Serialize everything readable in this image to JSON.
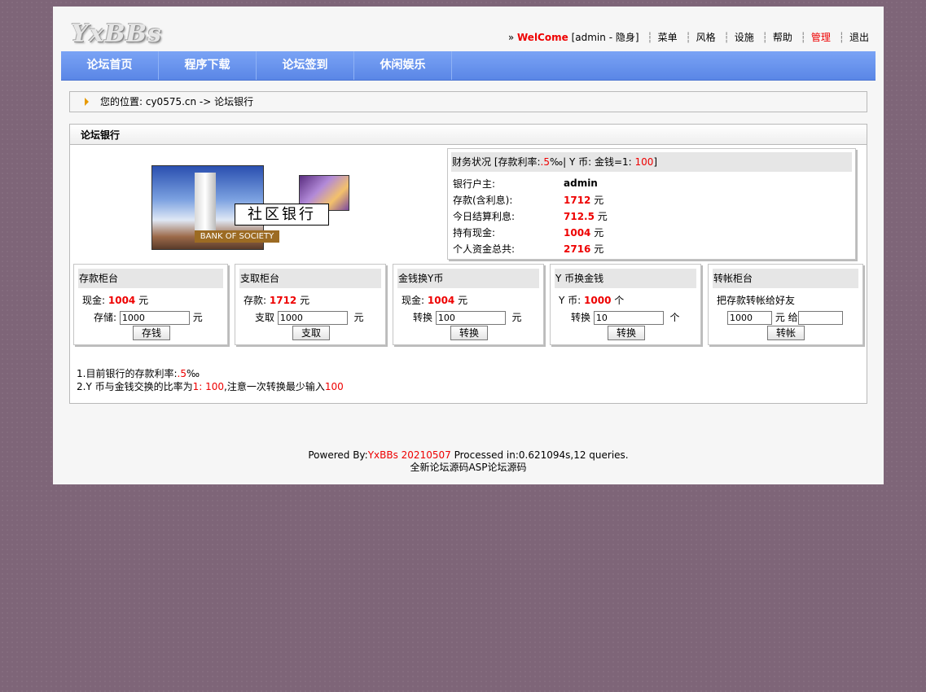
{
  "logo": "YxBBs",
  "topmenu": {
    "prefix": "»",
    "welcome": "WelCome",
    "user": "[admin - 隐身]",
    "items": [
      "菜单",
      "风格",
      "设施",
      "帮助"
    ],
    "manage": "管理",
    "logout": "退出"
  },
  "nav": [
    "论坛首页",
    "程序下载",
    "论坛签到",
    "休闲娱乐"
  ],
  "breadcrumb": "您的位置: cy0575.cn -> 论坛银行",
  "bank": {
    "title": "论坛银行",
    "image_text": "社区银行",
    "image_subtext": "BANK OF SOCIETY",
    "status": {
      "head_prefix": "财务状况 [存款利率:",
      "rate": ".5",
      "head_mid": "‰| Y 币: 金钱=1: ",
      "ratio": "100",
      "head_suffix": "]",
      "rows": [
        {
          "label": "银行户主:",
          "value": "admin",
          "unit": ""
        },
        {
          "label": "存款(含利息):",
          "value": "1712",
          "unit": "元"
        },
        {
          "label": "今日结算利息:",
          "value": "712.5",
          "unit": "元"
        },
        {
          "label": "持有现金:",
          "value": "1004",
          "unit": "元"
        },
        {
          "label": "个人资金总共:",
          "value": "2716",
          "unit": "元"
        }
      ]
    },
    "counters": [
      {
        "title": "存款柜台",
        "l1_label": "现金:",
        "l1_value": "1004",
        "l1_unit": "元",
        "l2_label": "存储:",
        "input": "1000",
        "l2_unit": "元",
        "button": "存钱"
      },
      {
        "title": "支取柜台",
        "l1_label": "存款:",
        "l1_value": "1712",
        "l1_unit": "元",
        "l2_label": "支取",
        "input": "1000",
        "l2_unit": "元",
        "button": "支取"
      },
      {
        "title": "金钱换Y币",
        "l1_label": "现金:",
        "l1_value": "1004",
        "l1_unit": "元",
        "l2_label": "转换",
        "input": "100",
        "l2_unit": "元",
        "button": "转换"
      },
      {
        "title": "Y 币换金钱",
        "l1_label": "Y 币:",
        "l1_value": "1000",
        "l1_unit": "个",
        "l2_label": "转换",
        "input": "10",
        "l2_unit": "个",
        "button": "转换"
      },
      {
        "title": "转帐柜台",
        "l1_label": "把存款转帐给好友",
        "l1_value": "",
        "l1_unit": "",
        "l2_label": "",
        "input": "1000",
        "l2_unit": "元 给",
        "button": "转帐",
        "input2": ""
      }
    ],
    "notes": {
      "n1_prefix": "1.目前银行的存款利率:",
      "n1_value": ".5",
      "n1_suffix": "‰",
      "n2_prefix": "2.Y 币与金钱交换的比率为",
      "n2_ratio": "1: 100",
      "n2_mid": ",注意一次转换最少输入",
      "n2_min": "100"
    }
  },
  "footer": {
    "powered": "Powered By:",
    "brand": "YxBBs 20210507",
    "processed": " Processed in:0.621094s,12 queries.",
    "line2": "全新论坛源码ASP论坛源码"
  }
}
